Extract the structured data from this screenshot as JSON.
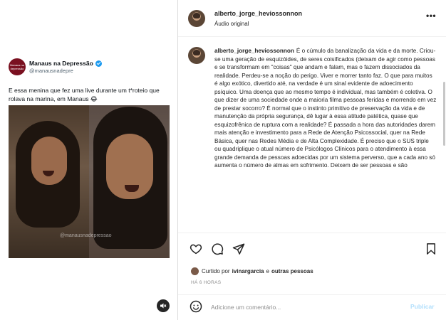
{
  "tweet": {
    "avatar_text": "Manaus na depressão",
    "name": "Manaus na Depressão",
    "handle": "@manausnadepre",
    "text": "E essa menina que fez uma live durante um t*roteio que rolava na marina, em Manaus 😂",
    "watermark": "@manausnadepressao"
  },
  "post": {
    "username": "alberto_jorge_heviossonnon",
    "subtitle": "Áudio original",
    "more_icon": "more-horizontal-icon",
    "caption_user": "alberto_jorge_heviossonnon",
    "caption_text": "É o cúmulo da banalização da vida e da morte. Criou-se uma geração de esquizóides, de seres coisificados (deixam de agir como pessoas e se transformam em \"coisas\" que andam e falam, mas o fazem dissociados da realidade. Perdeu-se a noção do perigo. Viver e morrer tanto faz. O que para muitos é algo exótico, divertido até, na verdade é um sinal evidente de adoecimento psíquico. Uma doença que ao mesmo tempo é individual, mas também é coletiva. O que dizer de uma sociedade onde a maioria filma pessoas feridas e morrendo em vez de prestar socorro? É normal que o instinto primitivo de preservação da vida e de manutenção da própria segurança, dê lugar à essa atitude patética, quase que esquizofrênica de ruptura com a realidade? É passada a hora das autoridades darem mais atenção e investimento para a Rede de Atenção Psicossocial, quer na Rede Básica, quer nas Redes Média e de Alta Complexidade. É preciso que o SUS triple ou quadriplique o atual número de Psicólogos Clínicos para o atendimento à essa grande demanda de pessoas adoecidas por um sistema perverso, que a cada ano só aumenta o número de almas em sofrimento. Deixem de ser pessoas e são"
  },
  "actions": {
    "like_icon": "heart-icon",
    "comment_icon": "comment-icon",
    "share_icon": "share-icon",
    "save_icon": "bookmark-icon"
  },
  "likes": {
    "prefix": "Curtido por",
    "user": "ivinargarcia",
    "connector": "e",
    "others": "outras pessoas"
  },
  "timestamp": "HÁ 6 HORAS",
  "comment": {
    "placeholder": "Adicione um comentário...",
    "publish": "Publicar",
    "emoji_icon": "emoji-icon"
  },
  "colors": {
    "accent": "#0095f6",
    "publish_disabled": "#b2dffc",
    "verified": "#1d9bf0"
  }
}
